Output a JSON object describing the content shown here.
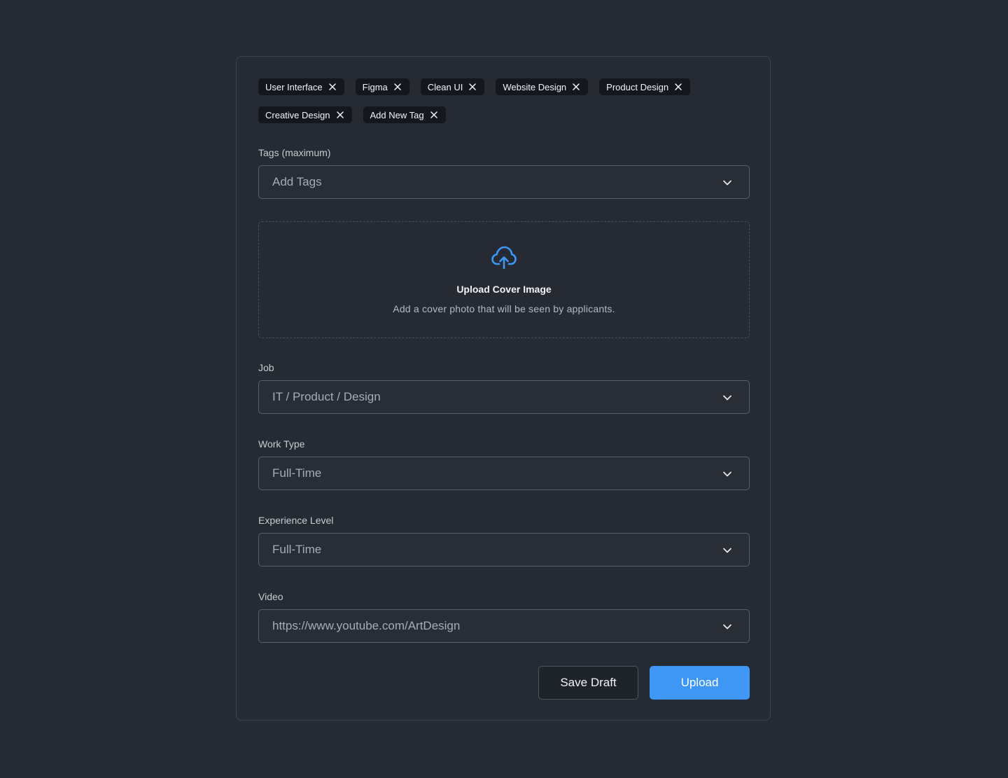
{
  "tags": [
    {
      "label": "User Interface"
    },
    {
      "label": "Figma"
    },
    {
      "label": "Clean UI"
    },
    {
      "label": "Website Design"
    },
    {
      "label": "Product Design"
    },
    {
      "label": "Creative Design"
    },
    {
      "label": "Add New Tag"
    }
  ],
  "tags_field": {
    "label": "Tags (maximum)",
    "placeholder": "Add Tags"
  },
  "upload": {
    "title": "Upload Cover Image",
    "subtitle": "Add a cover photo that will be seen by applicants."
  },
  "job": {
    "label": "Job",
    "value": "IT / Product / Design"
  },
  "work_type": {
    "label": "Work Type",
    "value": "Full-Time"
  },
  "experience": {
    "label": "Experience Level",
    "value": "Full-Time"
  },
  "video": {
    "label": "Video",
    "value": "https://www.youtube.com/ArtDesign"
  },
  "actions": {
    "save_draft": "Save Draft",
    "upload": "Upload"
  },
  "colors": {
    "background": "#262b33",
    "accent": "#3f97f5",
    "tag_bg": "#14181e"
  },
  "icons": {
    "tag_remove": "close-icon",
    "dropdown": "chevron-down-icon",
    "upload": "cloud-upload-icon"
  }
}
